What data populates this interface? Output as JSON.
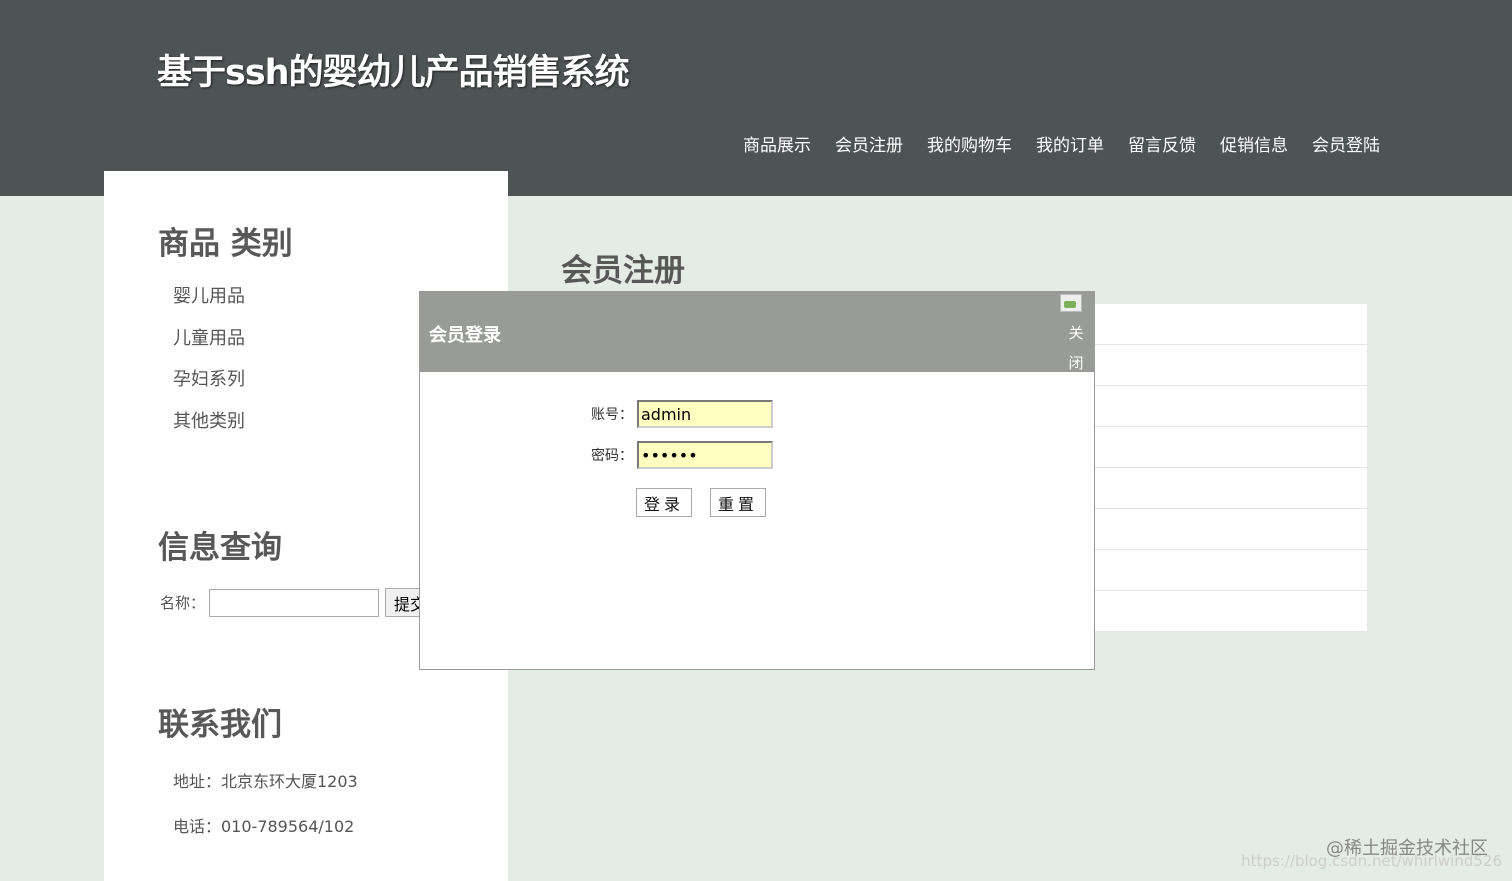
{
  "header": {
    "title": "基于ssh的婴幼儿产品销售系统",
    "nav": [
      "商品展示",
      "会员注册",
      "我的购物车",
      "我的订单",
      "留言反馈",
      "促销信息",
      "会员登陆"
    ]
  },
  "sidebar": {
    "category_heading": "商品 类别",
    "categories": [
      "婴儿用品",
      "儿童用品",
      "孕妇系列",
      "其他类别"
    ],
    "search_heading": "信息查询",
    "search_label": "名称：",
    "search_value": "",
    "search_button": "提交",
    "contact_heading": "联系我们",
    "address": "地址：北京东环大厦1203",
    "phone": "电话：010-789564/102"
  },
  "main": {
    "title": "会员注册"
  },
  "login_modal": {
    "title": "会员登录",
    "close_label": "关闭",
    "account_label": "账号：",
    "account_value": "admin",
    "password_label": "密码：",
    "password_value": "••••••",
    "login_button": "登录",
    "reset_button": "重置"
  },
  "watermark": {
    "text": "@稀土掘金技术社区",
    "url": "https://blog.csdn.net/whirlwind526"
  }
}
